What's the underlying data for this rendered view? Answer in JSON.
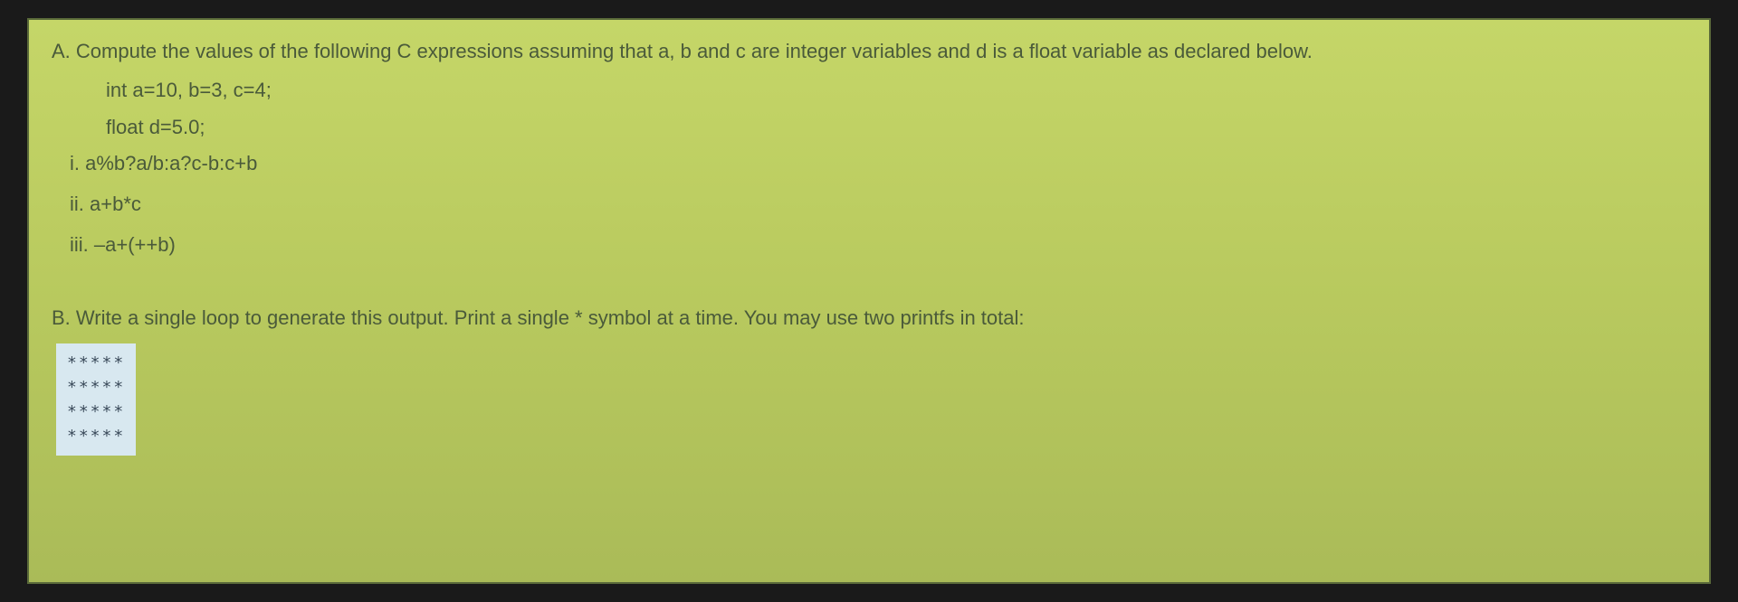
{
  "questionA": {
    "header": "A. Compute the values of the following C expressions assuming that a, b and c are integer variables and d is a float variable as declared below.",
    "declaration1": "int a=10, b=3, c=4;",
    "declaration2": "float d=5.0;",
    "item1": "i.  a%b?a/b:a?c-b:c+b",
    "item2": "ii.  a+b*c",
    "item3": "iii. –a+(++b)"
  },
  "questionB": {
    "header": "B. Write a single loop to generate this output. Print a single * symbol at a time. You may use two printfs in total:",
    "output": [
      "*****",
      "*****",
      "*****",
      "*****"
    ]
  }
}
